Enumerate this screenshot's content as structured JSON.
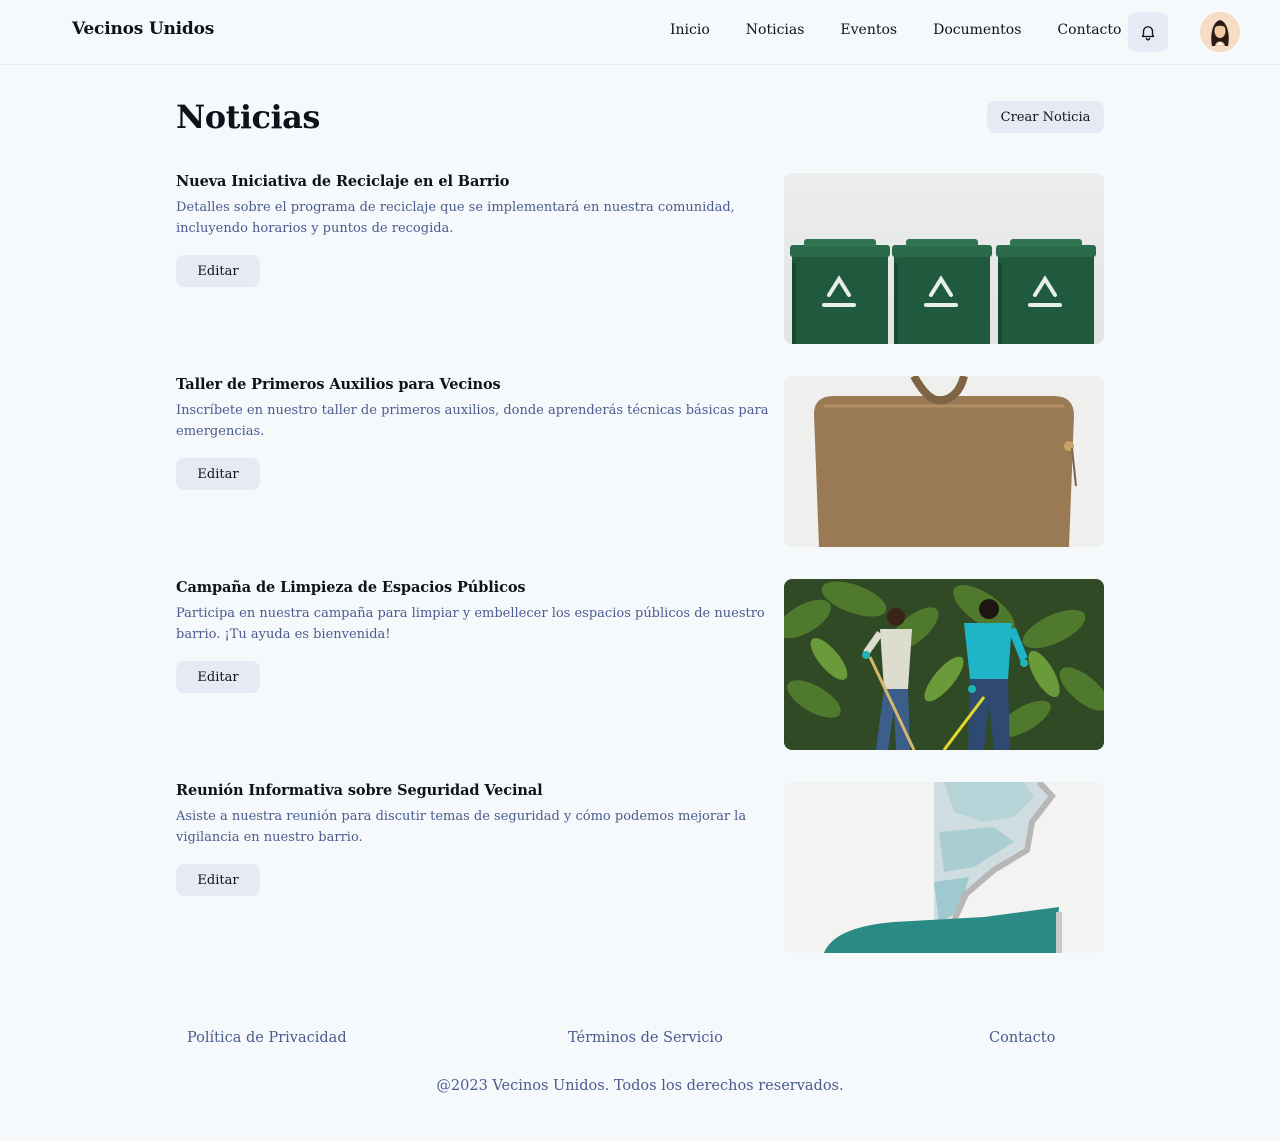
{
  "header": {
    "brand": "Vecinos Unidos",
    "nav": [
      "Inicio",
      "Noticias",
      "Eventos",
      "Documentos",
      "Contacto"
    ],
    "notifications_icon": "bell-icon",
    "avatar_icon": "user-avatar"
  },
  "main": {
    "title": "Noticias",
    "create_label": "Crear Noticia",
    "items": [
      {
        "title": "Nueva Iniciativa de Reciclaje en el Barrio",
        "description": "Detalles sobre el programa de reciclaje que se implementará en nuestra comunidad, incluyendo horarios y puntos de recogida.",
        "edit_label": "Editar",
        "image": "recycling-bins"
      },
      {
        "title": "Taller de Primeros Auxilios para Vecinos",
        "description": "Inscríbete en nuestro taller de primeros auxilios, donde aprenderás técnicas básicas para emergencias.",
        "edit_label": "Editar",
        "image": "first-aid-bag"
      },
      {
        "title": "Campaña de Limpieza de Espacios Públicos",
        "description": "Participa en nuestra campaña para limpiar y embellecer los espacios públicos de nuestro barrio. ¡Tu ayuda es bienvenida!",
        "edit_label": "Editar",
        "image": "cleanup-volunteers"
      },
      {
        "title": "Reunión Informativa sobre Seguridad Vecinal",
        "description": "Asiste a nuestra reunión para discutir temas de seguridad y cómo podemos mejorar la vigilancia en nuestro barrio.",
        "edit_label": "Editar",
        "image": "abstract-map"
      }
    ]
  },
  "footer": {
    "links": [
      "Política de Privacidad",
      "Términos de Servicio",
      "Contacto"
    ],
    "copyright": "@2023 Vecinos Unidos. Todos los derechos reservados."
  },
  "colors": {
    "background": "#f6f9fc",
    "button": "#e7e9f4",
    "muted_text": "#4a5b8f",
    "text": "#0e121b"
  }
}
